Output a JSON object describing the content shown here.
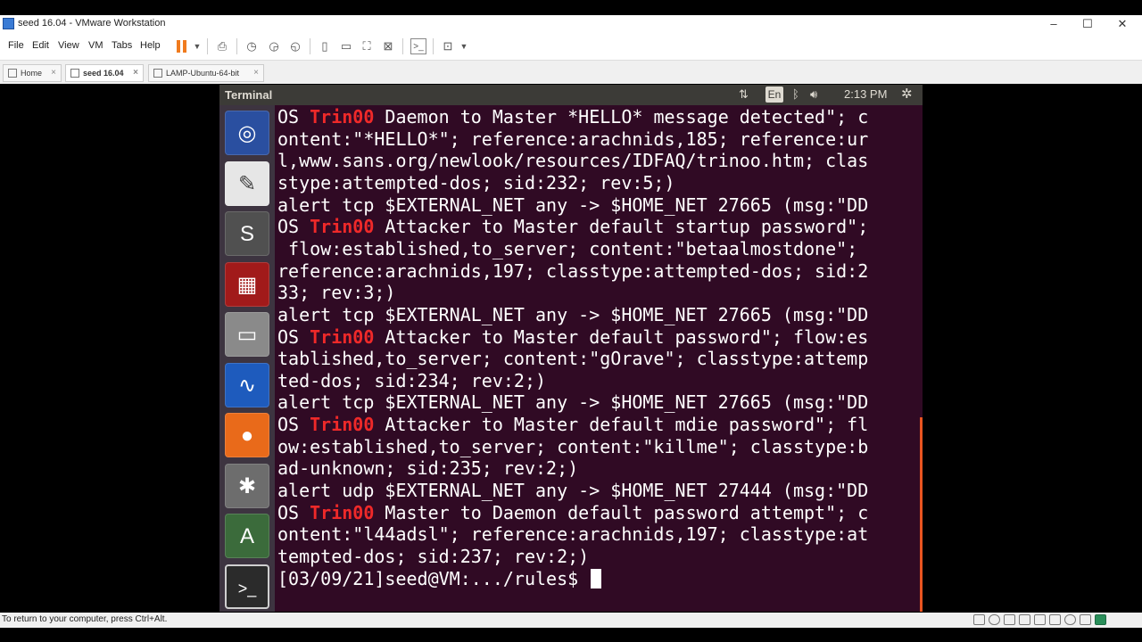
{
  "window": {
    "title": "seed 16.04 - VMware Workstation",
    "controls": [
      "–",
      "☐",
      "✕"
    ]
  },
  "menu": [
    "File",
    "Edit",
    "View",
    "VM",
    "Tabs",
    "Help"
  ],
  "tabs": [
    {
      "label": "Home",
      "close": "×"
    },
    {
      "label": "seed 16.04",
      "close": "×"
    },
    {
      "label": "LAMP-Ubuntu-64-bit",
      "close": "×"
    }
  ],
  "guest_panel": {
    "title": "Terminal",
    "language": "En",
    "time": "2:13 PM"
  },
  "launcher": [
    {
      "name": "ubuntu-dash",
      "glyph": "◎",
      "bg": "#2a4fa0"
    },
    {
      "name": "text-editor",
      "glyph": "✎",
      "bg": "#e6e6e6"
    },
    {
      "name": "sublime-text",
      "glyph": "S",
      "bg": "#505050"
    },
    {
      "name": "red-app",
      "glyph": "▦",
      "bg": "#a11a1a"
    },
    {
      "name": "files",
      "glyph": "▭",
      "bg": "#8a8a8a"
    },
    {
      "name": "wireshark",
      "glyph": "∿",
      "bg": "#1e5bbd"
    },
    {
      "name": "firefox",
      "glyph": "●",
      "bg": "#e96a1a"
    },
    {
      "name": "settings",
      "glyph": "✱",
      "bg": "#6d6d6d"
    },
    {
      "name": "software-updater",
      "glyph": "A",
      "bg": "#3b6b3b"
    },
    {
      "name": "terminal",
      "glyph": ">_",
      "bg": "#2b2b2b"
    }
  ],
  "terminal": {
    "lines": [
      [
        {
          "t": "OS "
        },
        {
          "t": "Trin00",
          "r": true
        },
        {
          "t": " Daemon to Master *HELLO* message detected\"; c"
        }
      ],
      [
        {
          "t": "ontent:\"*HELLO*\"; reference:arachnids,185; reference:ur"
        }
      ],
      [
        {
          "t": "l,www.sans.org/newlook/resources/IDFAQ/trinoo.htm; clas"
        }
      ],
      [
        {
          "t": "stype:attempted-dos; sid:232; rev:5;)"
        }
      ],
      [
        {
          "t": "alert tcp $EXTERNAL_NET any -> $HOME_NET 27665 (msg:\"DD"
        }
      ],
      [
        {
          "t": "OS "
        },
        {
          "t": "Trin00",
          "r": true
        },
        {
          "t": " Attacker to Master default startup password\";"
        }
      ],
      [
        {
          "t": " flow:established,to_server; content:\"betaalmostdone\";"
        }
      ],
      [
        {
          "t": "reference:arachnids,197; classtype:attempted-dos; sid:2"
        }
      ],
      [
        {
          "t": "33; rev:3;)"
        }
      ],
      [
        {
          "t": "alert tcp $EXTERNAL_NET any -> $HOME_NET 27665 (msg:\"DD"
        }
      ],
      [
        {
          "t": "OS "
        },
        {
          "t": "Trin00",
          "r": true
        },
        {
          "t": " Attacker to Master default password\"; flow:es"
        }
      ],
      [
        {
          "t": "tablished,to_server; content:\"gOrave\"; classtype:attemp"
        }
      ],
      [
        {
          "t": "ted-dos; sid:234; rev:2;)"
        }
      ],
      [
        {
          "t": "alert tcp $EXTERNAL_NET any -> $HOME_NET 27665 (msg:\"DD"
        }
      ],
      [
        {
          "t": "OS "
        },
        {
          "t": "Trin00",
          "r": true
        },
        {
          "t": " Attacker to Master default mdie password\"; fl"
        }
      ],
      [
        {
          "t": "ow:established,to_server; content:\"killme\"; classtype:b"
        }
      ],
      [
        {
          "t": "ad-unknown; sid:235; rev:2;)"
        }
      ],
      [
        {
          "t": "alert udp $EXTERNAL_NET any -> $HOME_NET 27444 (msg:\"DD"
        }
      ],
      [
        {
          "t": "OS "
        },
        {
          "t": "Trin00",
          "r": true
        },
        {
          "t": " Master to Daemon default password attempt\"; c"
        }
      ],
      [
        {
          "t": "ontent:\"l44adsl\"; reference:arachnids,197; classtype:at"
        }
      ],
      [
        {
          "t": "tempted-dos; sid:237; rev:2;)"
        }
      ]
    ],
    "prompt": "[03/09/21]seed@VM:.../rules$ "
  },
  "statusbar": {
    "text": "To return to your computer, press Ctrl+Alt."
  },
  "colors": {
    "terminal_bg": "#300a24",
    "highlight": "#ef2929",
    "panel": "#3c3b37",
    "launcher": "#3d3440"
  }
}
